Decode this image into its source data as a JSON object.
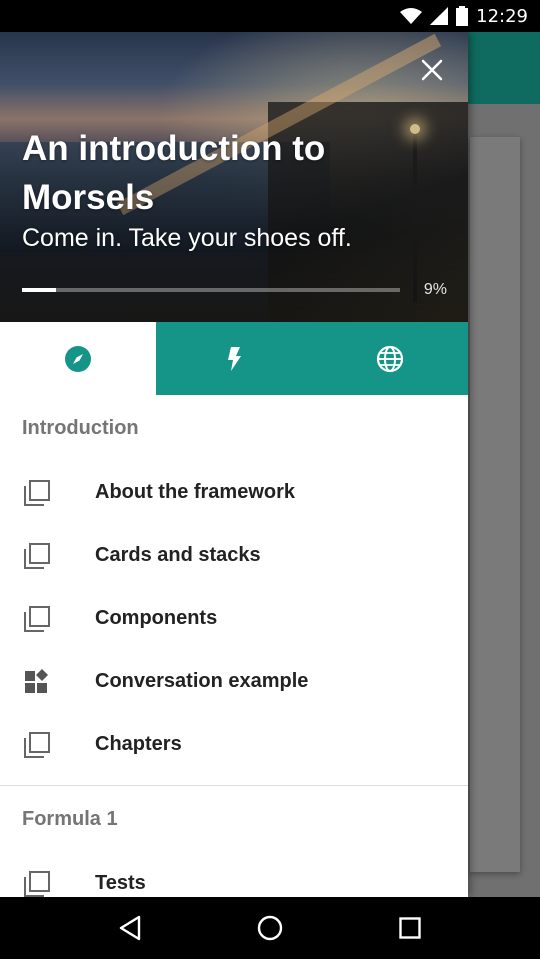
{
  "status_bar": {
    "time": "12:29",
    "icons": [
      "wifi-icon",
      "signal-icon",
      "battery-icon"
    ]
  },
  "drawer": {
    "hero": {
      "title": "An introduction to Morsels",
      "subtitle": "Come in. Take your shoes off.",
      "progress_percent": 9,
      "progress_label": "9%",
      "close_icon": "close-icon"
    },
    "tabs": [
      {
        "icon": "compass-icon",
        "active": true
      },
      {
        "icon": "lightning-icon",
        "active": false
      },
      {
        "icon": "globe-icon",
        "active": false
      }
    ],
    "sections": [
      {
        "title": "Introduction",
        "items": [
          {
            "label": "About the framework",
            "icon": "stack-icon"
          },
          {
            "label": "Cards and stacks",
            "icon": "stack-icon"
          },
          {
            "label": "Components",
            "icon": "stack-icon"
          },
          {
            "label": "Conversation example",
            "icon": "widgets-icon"
          },
          {
            "label": "Chapters",
            "icon": "stack-icon"
          }
        ]
      },
      {
        "title": "Formula 1",
        "items": [
          {
            "label": "Tests",
            "icon": "stack-icon"
          }
        ]
      }
    ]
  },
  "colors": {
    "accent": "#159587",
    "app_bar": "#0f6b5f",
    "status_bar": "#000000"
  },
  "nav_bar": {
    "buttons": [
      "back-icon",
      "home-icon",
      "recents-icon"
    ]
  }
}
